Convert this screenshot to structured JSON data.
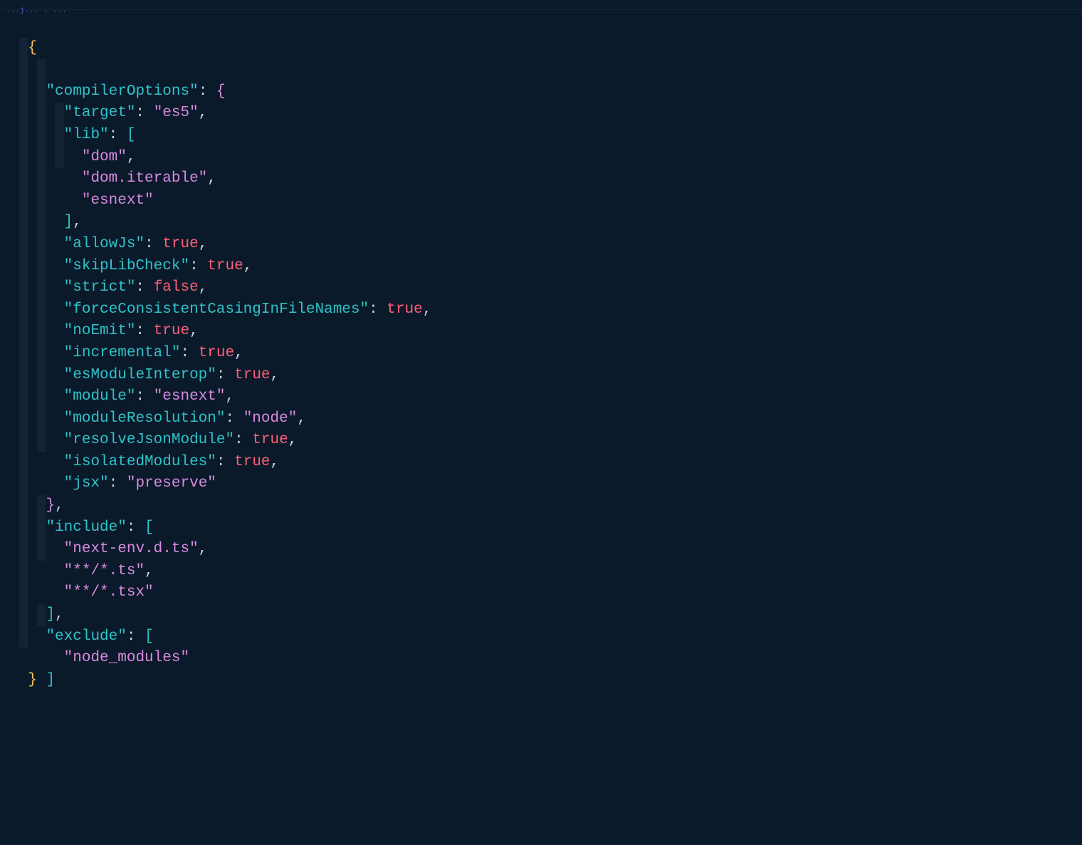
{
  "header": {
    "filename_fragment": "...j... . ..."
  },
  "json": {
    "compilerOptions_key": "\"compilerOptions\"",
    "target_key": "\"target\"",
    "target_val": "\"es5\"",
    "lib_key": "\"lib\"",
    "lib_vals": [
      "\"dom\"",
      "\"dom.iterable\"",
      "\"esnext\""
    ],
    "allowJs_key": "\"allowJs\"",
    "allowJs_val": "true",
    "skipLibCheck_key": "\"skipLibCheck\"",
    "skipLibCheck_val": "true",
    "strict_key": "\"strict\"",
    "strict_val": "false",
    "forceCasing_key": "\"forceConsistentCasingInFileNames\"",
    "forceCasing_val": "true",
    "noEmit_key": "\"noEmit\"",
    "noEmit_val": "true",
    "incremental_key": "\"incremental\"",
    "incremental_val": "true",
    "esModuleInterop_key": "\"esModuleInterop\"",
    "esModuleInterop_val": "true",
    "module_key": "\"module\"",
    "module_val": "\"esnext\"",
    "moduleResolution_key": "\"moduleResolution\"",
    "moduleResolution_val": "\"node\"",
    "resolveJsonModule_key": "\"resolveJsonModule\"",
    "resolveJsonModule_val": "true",
    "isolatedModules_key": "\"isolatedModules\"",
    "isolatedModules_val": "true",
    "jsx_key": "\"jsx\"",
    "jsx_val": "\"preserve\"",
    "include_key": "\"include\"",
    "include_vals": [
      "\"next-env.d.ts\"",
      "\"**/*.ts\"",
      "\"**/*.tsx\""
    ],
    "exclude_key": "\"exclude\"",
    "exclude_vals": [
      "\"node_modules\""
    ]
  },
  "indent": {
    "i0": "",
    "i1": "  ",
    "i2": "    ",
    "i3": "      "
  }
}
